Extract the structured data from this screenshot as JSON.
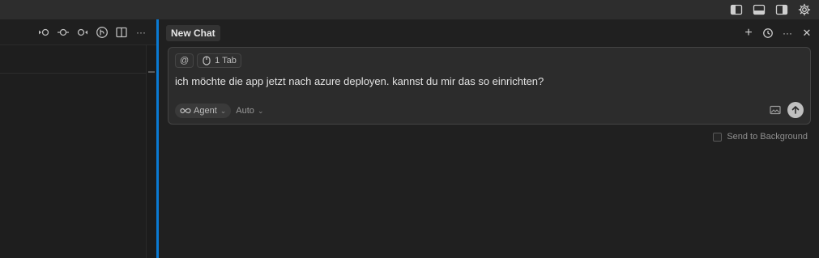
{
  "titlebar": {
    "icons": [
      "toggle-primary-sidebar-icon",
      "toggle-panel-icon",
      "toggle-secondary-sidebar-icon",
      "settings-gear-icon"
    ]
  },
  "left_toolbar": {
    "icons": [
      "go-back-icon",
      "history-icon",
      "go-forward-icon",
      "source-control-icon",
      "split-editor-icon",
      "more-actions-icon"
    ],
    "more_label": "···"
  },
  "chat": {
    "tab_label": "New Chat",
    "actions": {
      "new_label": "+",
      "more_label": "···",
      "close_label": "✕"
    },
    "composer": {
      "mention_label": "@",
      "context_chip_label": "1 Tab",
      "text": "ich möchte die app jetzt nach azure deployen. kannst du mir das so einrichten?",
      "mode_label": "Agent",
      "model_label": "Auto"
    },
    "send_to_background_label": "Send to Background"
  },
  "colors": {
    "accent_splitter": "#0a7ad3",
    "send_button": "#bfbfbf"
  }
}
